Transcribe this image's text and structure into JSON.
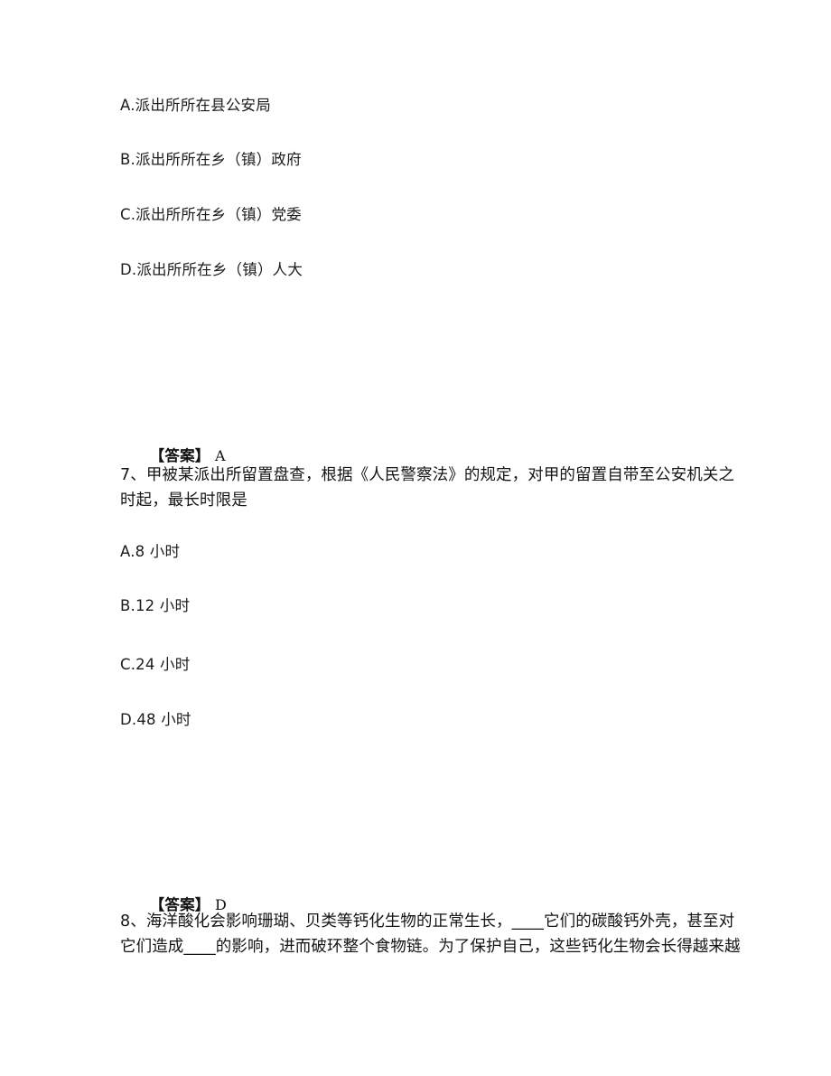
{
  "page": {
    "background_color": "#ffffff",
    "text_color": "#1a1a1a"
  },
  "question_6": {
    "options": [
      {
        "key": "A",
        "text": "A.派出所所在县公安局"
      },
      {
        "key": "B",
        "text": "B.派出所所在乡（镇）政府"
      },
      {
        "key": "C",
        "text": "C.派出所所在乡（镇）党委"
      },
      {
        "key": "D",
        "text": "D.派出所所在乡（镇）人大"
      }
    ],
    "answer_label": "【答案】",
    "answer_value": "A"
  },
  "question_7": {
    "number": "7、",
    "stem_line_1": "7、甲被某派出所留置盘查，根据《人民警察法》的规定，对甲的留置自带至公安机关之",
    "stem_line_2": "时起，最长时限是",
    "options": [
      {
        "key": "A",
        "text": "A.8 小时"
      },
      {
        "key": "B",
        "text": "B.12 小时"
      },
      {
        "key": "C",
        "text": "C.24 小时"
      },
      {
        "key": "D",
        "text": "D.48 小时"
      }
    ],
    "answer_label": "【答案】",
    "answer_value": "D"
  },
  "question_8": {
    "number": "8、",
    "stem_line_1": "8、海洋酸化会影响珊瑚、贝类等钙化生物的正常生长，____它们的碳酸钙外壳，甚至对",
    "stem_line_2": "它们造成____的影响，进而破环整个食物链。为了保护自己，这些钙化生物会长得越来越"
  }
}
